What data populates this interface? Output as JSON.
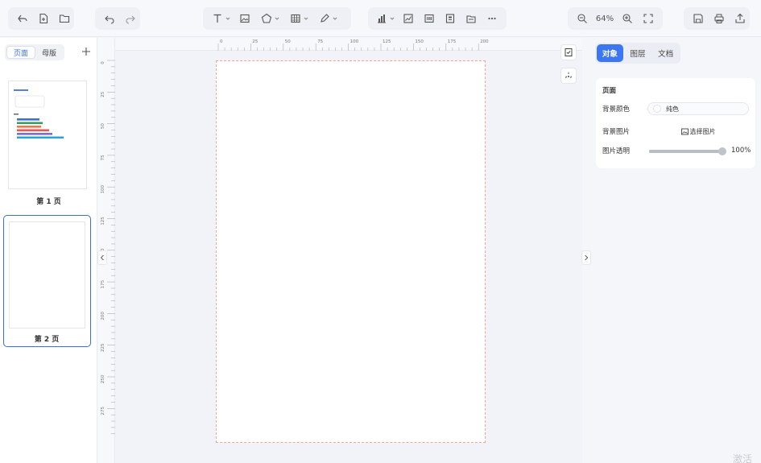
{
  "toolbar": {
    "zoom_level": "64%"
  },
  "left_panel": {
    "tabs": [
      {
        "label": "页面",
        "active": true
      },
      {
        "label": "母版",
        "active": false
      }
    ],
    "pages": [
      {
        "label": "第 1 页",
        "active": false
      },
      {
        "label": "第 2 页",
        "active": true
      }
    ],
    "thumb1_bar_colors": [
      "#3b6fe0",
      "#3a9a63",
      "#e57a4a",
      "#e45a5a",
      "#7e6ad6",
      "#2aa1e0"
    ]
  },
  "rulers": {
    "horizontal": [
      "0",
      "25",
      "50",
      "75",
      "100",
      "125",
      "150",
      "175",
      "200"
    ],
    "vertical": [
      "0",
      "25",
      "50",
      "75",
      "100",
      "125",
      "150",
      "175",
      "200",
      "225",
      "250",
      "275"
    ]
  },
  "right_panel": {
    "tabs": [
      {
        "label": "对象",
        "active": true
      },
      {
        "label": "图层",
        "active": false
      },
      {
        "label": "文档",
        "active": false
      }
    ],
    "section_title": "页面",
    "bg_color_label": "背景颜色",
    "bg_color_value": "纯色",
    "bg_image_label": "背景图片",
    "bg_image_button": "选择图片",
    "opacity_label": "图片透明",
    "opacity_value": "100%",
    "opacity_fraction": 1.0
  },
  "watermark": "激活 W",
  "colors": {
    "accent": "#3c76f0",
    "page_border": "#f2a58e"
  }
}
